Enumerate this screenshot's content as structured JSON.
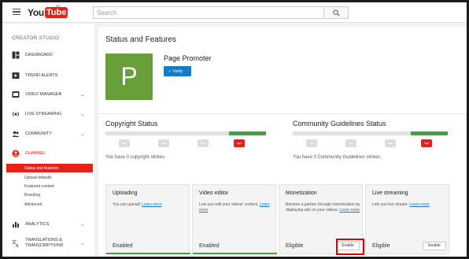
{
  "header": {
    "logo_you": "You",
    "logo_tube": "Tube",
    "logo_region": "IN",
    "search_placeholder": "Search"
  },
  "sidebar": {
    "section_title": "CREATOR STUDIO",
    "items": [
      {
        "label": "DASHBOARD",
        "icon": "dashboard-icon"
      },
      {
        "label": "TREND ALERTS",
        "icon": "trend-icon"
      },
      {
        "label": "VIDEO MANAGER",
        "icon": "video-manager-icon"
      },
      {
        "label": "LIVE STREAMING",
        "icon": "live-icon"
      },
      {
        "label": "COMMUNITY",
        "icon": "community-icon"
      },
      {
        "label": "CHANNEL",
        "icon": "channel-icon"
      }
    ],
    "channel_sub": [
      "Status and features",
      "Upload defaults",
      "Featured content",
      "Branding",
      "Advanced"
    ],
    "bottom_items": [
      {
        "label": "ANALYTICS",
        "icon": "analytics-icon"
      },
      {
        "label_line1": "TRANSLATIONS &",
        "label_line2": "TRANSCRIPTIONS",
        "icon": "translate-icon"
      }
    ]
  },
  "main": {
    "title": "Status and Features",
    "avatar_letter": "P",
    "channel_name": "Page Promoter",
    "verify_label": "Verify",
    "copyright": {
      "title": "Copyright Status",
      "text": "You have 0 copyright strikes."
    },
    "community": {
      "title": "Community Guidelines Status",
      "text": "You have 0 Community Guidelines strikes."
    },
    "cards": [
      {
        "title": "Uploading",
        "desc": "You can upload!",
        "link": "Learn more",
        "status": "Enabled"
      },
      {
        "title": "Video editor",
        "desc": "Lets you edit your videos' content.",
        "link": "Learn more",
        "status": "Enabled"
      },
      {
        "title": "Monetization",
        "desc": "Become a partner through monetization by displaying ads on your videos.",
        "link": "Learn more",
        "status": "Eligible",
        "button": "Enable"
      },
      {
        "title": "Live streaming",
        "desc": "Lets you live stream.",
        "link": "Learn more",
        "status": "Eligible",
        "button": "Enable"
      }
    ]
  },
  "colors": {
    "brand_red": "#e62117",
    "accent_blue": "#167ac6",
    "success_green": "#41a33f",
    "avatar_green": "#689f38"
  }
}
